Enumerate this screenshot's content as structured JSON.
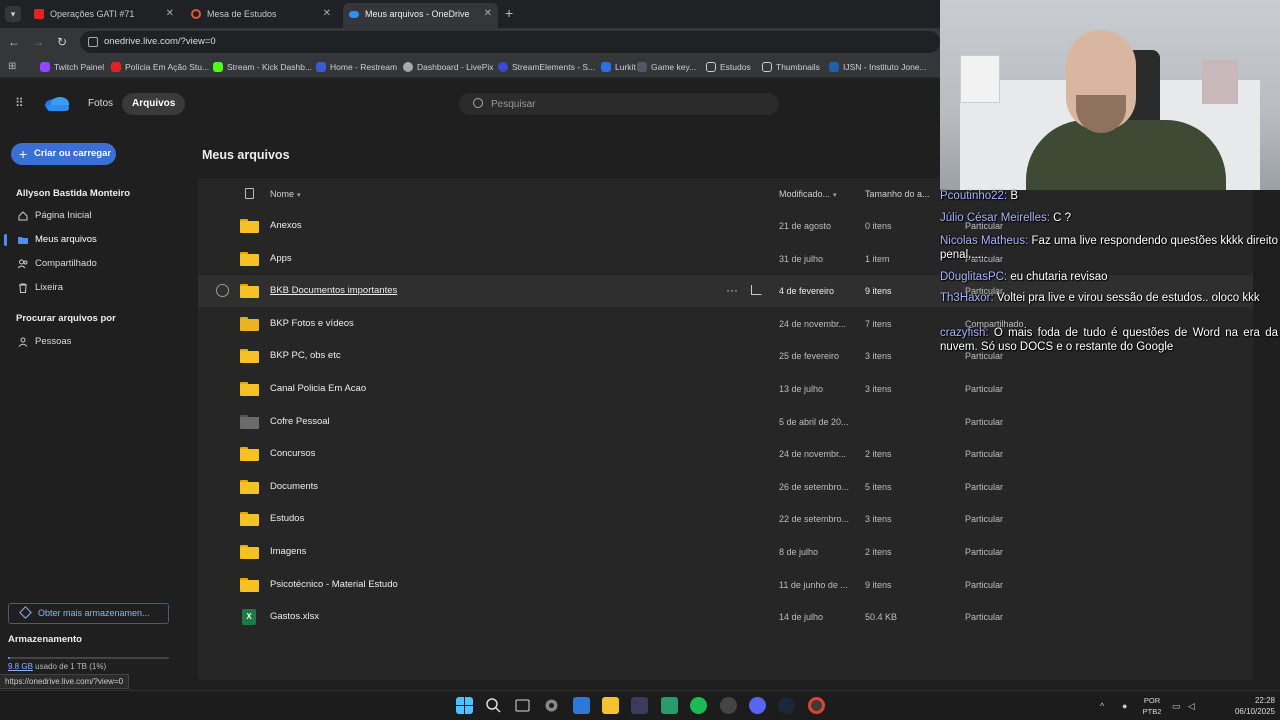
{
  "browser": {
    "tabs": [
      {
        "label": "Operações GATI #71 ",
        "active": false
      },
      {
        "label": "Mesa de Estudos",
        "active": false
      },
      {
        "label": "Meus arquivos - OneDrive",
        "active": true
      }
    ],
    "url": "onedrive.live.com/?view=0",
    "bookmarks": [
      "Twitch Painel",
      "Polícia Em Ação Stu...",
      "Stream - Kick Dashb...",
      "Home - Restream",
      "Dashboard - LivePix",
      "StreamElements - S...",
      "Lurkit",
      "Game key...",
      "Estudos",
      "Thumbnails",
      "IJSN - Instituto Jone..."
    ],
    "status_url": "https://onedrive.live.com/?view=0"
  },
  "header": {
    "pill_photos": "Fotos",
    "pill_files": "Arquivos",
    "search_placeholder": "Pesquisar"
  },
  "sidebar": {
    "create_label": "Criar ou carregar",
    "user_name": "Allyson Bastida Monteiro",
    "items": [
      {
        "label": "Página Inicial",
        "icon": "home-icon"
      },
      {
        "label": "Meus arquivos",
        "icon": "folder-icon"
      },
      {
        "label": "Compartilhado",
        "icon": "people-icon"
      },
      {
        "label": "Lixeira",
        "icon": "trash-icon"
      }
    ],
    "browse_heading": "Procurar arquivos por",
    "people_label": "Pessoas",
    "more_storage_label": "Obter mais armazenamen...",
    "storage_title": "Armazenamento",
    "storage_used_amount": "9.8 GB",
    "storage_used_rest": " usado de 1 TB (1%)",
    "storage_fraction": 0.01
  },
  "main": {
    "title": "Meus arquivos",
    "columns": {
      "name": "Nome",
      "modified": "Modificado...",
      "size": "Tamanho do a..."
    },
    "rows": [
      {
        "name": "Anexos",
        "modified": "21 de agosto",
        "size": "0 itens",
        "sharing": "Particular",
        "kind": "folder"
      },
      {
        "name": "Apps",
        "modified": "31 de julho",
        "size": "1 item",
        "sharing": "Particular",
        "kind": "folder"
      },
      {
        "name": "BKB Documentos importantes",
        "modified": "4 de fevereiro",
        "size": "9 itens",
        "sharing": "Particular",
        "kind": "folder"
      },
      {
        "name": "BKP Fotos e vídeos",
        "modified": "24 de novembr...",
        "size": "7 itens",
        "sharing": "Compartilhado",
        "kind": "folder-special"
      },
      {
        "name": "BKP PC, obs etc",
        "modified": "25 de fevereiro",
        "size": "3 itens",
        "sharing": "Particular",
        "kind": "folder"
      },
      {
        "name": "Canal Policia Em Acao",
        "modified": "13 de julho",
        "size": "3 itens",
        "sharing": "Particular",
        "kind": "folder"
      },
      {
        "name": "Cofre Pessoal",
        "modified": "5 de abril de 20...",
        "size": "",
        "sharing": "Particular",
        "kind": "vault"
      },
      {
        "name": "Concursos",
        "modified": "24 de novembr...",
        "size": "2 itens",
        "sharing": "Particular",
        "kind": "folder"
      },
      {
        "name": "Documents",
        "modified": "26 de setembro...",
        "size": "5 itens",
        "sharing": "Particular",
        "kind": "folder"
      },
      {
        "name": "Estudos",
        "modified": "22 de setembro...",
        "size": "3 itens",
        "sharing": "Particular",
        "kind": "folder"
      },
      {
        "name": "Imagens",
        "modified": "8 de julho",
        "size": "2 itens",
        "sharing": "Particular",
        "kind": "folder"
      },
      {
        "name": "Psicotécnico - Material Estudo",
        "modified": "11 de junho de ...",
        "size": "9 itens",
        "sharing": "Particular",
        "kind": "folder"
      },
      {
        "name": "Gastos.xlsx",
        "modified": "14 de julho",
        "size": "50.4 KB",
        "sharing": "Particular",
        "kind": "xlsx"
      }
    ]
  },
  "chat": [
    {
      "author": "Pcoutinho22:",
      "text": " B"
    },
    {
      "author": "Júlio César Meirelles:",
      "text": " C ?"
    },
    {
      "author": "Nicolas Matheus:",
      "text": " Faz uma live respondendo questões kkkk direito penal......"
    },
    {
      "author": "D0uglitasPC:",
      "text": " eu chutaria revisao"
    },
    {
      "author": "Th3Haxor:",
      "text": " Voltei pra live e virou sessão de estudos.. oloco kkk"
    },
    {
      "author": "crazyfish:",
      "text": " O mais foda de tudo é questões de Word na era da nuvem. Só uso DOCS e o restante do Google"
    }
  ],
  "taskbar": {
    "lang_top": "POR",
    "lang_bottom": "PTB2",
    "time": "22:28",
    "date": "06/10/2025"
  }
}
